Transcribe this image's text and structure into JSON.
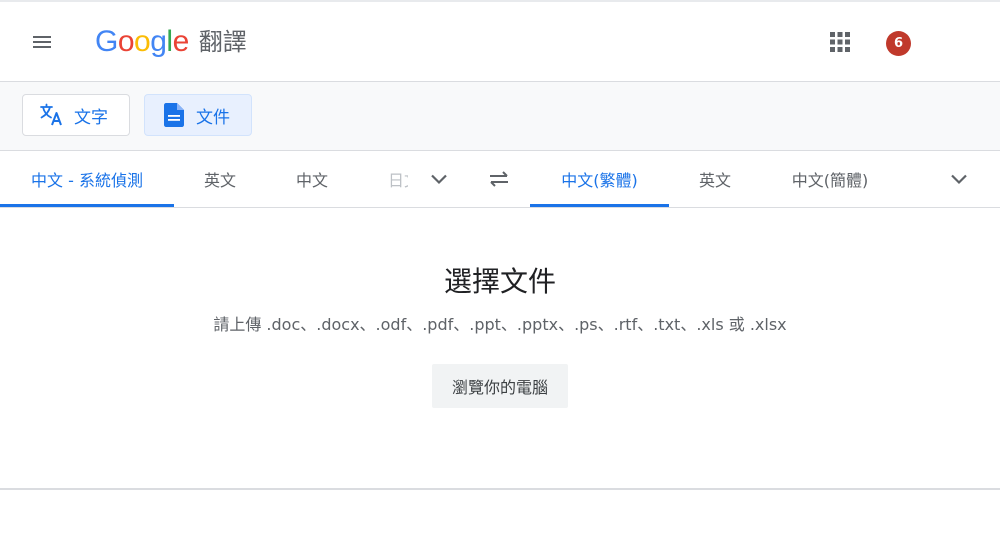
{
  "header": {
    "logo_letters": [
      {
        "char": "G",
        "color": "#4285F4"
      },
      {
        "char": "o",
        "color": "#EA4335"
      },
      {
        "char": "o",
        "color": "#FBBC05"
      },
      {
        "char": "g",
        "color": "#4285F4"
      },
      {
        "char": "l",
        "color": "#34A853"
      },
      {
        "char": "e",
        "color": "#EA4335"
      }
    ],
    "product_name": "翻譯",
    "notification_count": "6",
    "avatar_color": "#C0392B"
  },
  "modes": [
    {
      "label": "文字",
      "icon": "translate-icon",
      "active": false
    },
    {
      "label": "文件",
      "icon": "document-icon",
      "active": true
    }
  ],
  "source_languages": [
    "中文 - 系統偵測",
    "英文",
    "中文",
    "日文"
  ],
  "target_languages": [
    "中文(繁體)",
    "英文",
    "中文(簡體)"
  ],
  "panel": {
    "title": "選擇文件",
    "subtitle": "請上傳 .doc、.docx、.odf、.pdf、.ppt、.pptx、.ps、.rtf、.txt、.xls 或 .xlsx",
    "browse_label": "瀏覽你的電腦"
  },
  "colors": {
    "accent": "#1a73e8",
    "icon_gray": "#5f6368",
    "border": "#dadce0"
  }
}
